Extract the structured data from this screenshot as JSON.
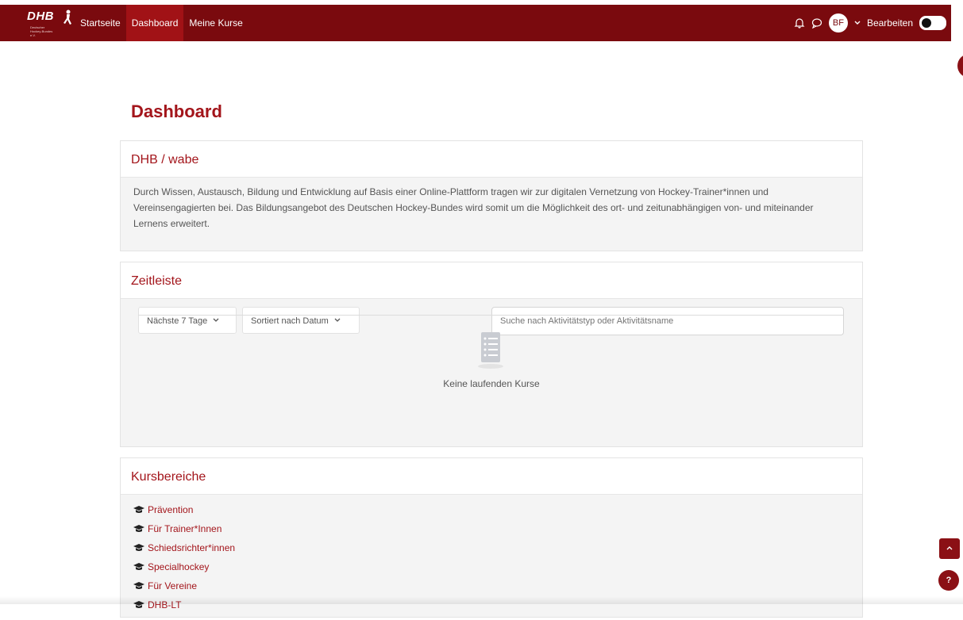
{
  "navbar": {
    "logo_text": "DHB",
    "logo_sub": "Deutscher Hockey-Bundes e.V.",
    "items": [
      {
        "label": "Startseite",
        "active": false
      },
      {
        "label": "Dashboard",
        "active": true
      },
      {
        "label": "Meine Kurse",
        "active": false
      }
    ],
    "avatar_initials": "BF",
    "edit_label": "Bearbeiten"
  },
  "page": {
    "title": "Dashboard"
  },
  "about": {
    "title": "DHB / wabe",
    "text": "Durch Wissen, Austausch, Bildung und Entwicklung auf Basis einer Online-Plattform tragen wir zur digitalen Vernetzung von Hockey-Trainer*innen und Vereinsengagierten bei. Das Bildungsangebot des Deutschen Hockey-Bundes wird somit um die Möglichkeit des ort- und zeitunabhängigen von- und miteinander Lernens erweitert."
  },
  "timeline": {
    "title": "Zeitleiste",
    "range_label": "Nächste 7 Tage",
    "sort_label": "Sortiert nach Datum",
    "search_placeholder": "Suche nach Aktivitätstyp oder Aktivitätsname",
    "empty_text": "Keine laufenden Kurse"
  },
  "categories": {
    "title": "Kursbereiche",
    "items": [
      "Prävention",
      "Für Trainer*Innen",
      "Schiedsrichter*innen",
      "Specialhockey",
      "Für Vereine",
      "DHB-LT"
    ]
  },
  "help_label": "?",
  "colors": {
    "brand": "#7a0a0e",
    "accent": "#a3151b",
    "active_nav": "#a11216"
  }
}
